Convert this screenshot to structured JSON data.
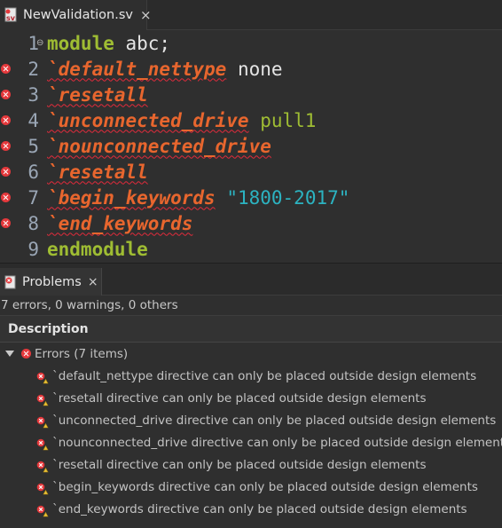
{
  "editor_tab": {
    "title": "NewValidation.sv",
    "close": "×",
    "icon": "sv-file-icon"
  },
  "code_lines": [
    {
      "num": "1",
      "error": false,
      "fold": "⊖",
      "tokens": [
        {
          "cls": "kw",
          "t": "module"
        },
        {
          "cls": "id",
          "t": " abc;"
        }
      ]
    },
    {
      "num": "2",
      "error": true,
      "fold": "",
      "tokens": [
        {
          "cls": "dir",
          "t": "`default_nettype"
        },
        {
          "cls": "id",
          "t": " none"
        }
      ]
    },
    {
      "num": "3",
      "error": true,
      "fold": "",
      "tokens": [
        {
          "cls": "dir",
          "t": "`resetall"
        }
      ]
    },
    {
      "num": "4",
      "error": true,
      "fold": "",
      "tokens": [
        {
          "cls": "dir",
          "t": "`unconnected_drive"
        },
        {
          "cls": "num",
          "t": " pull1"
        }
      ]
    },
    {
      "num": "5",
      "error": true,
      "fold": "",
      "tokens": [
        {
          "cls": "dir",
          "t": "`nounconnected_drive"
        }
      ]
    },
    {
      "num": "6",
      "error": true,
      "fold": "",
      "tokens": [
        {
          "cls": "dir",
          "t": "`resetall"
        }
      ]
    },
    {
      "num": "7",
      "error": true,
      "fold": "",
      "tokens": [
        {
          "cls": "dir",
          "t": "`begin_keywords"
        },
        {
          "cls": "id",
          "t": " "
        },
        {
          "cls": "str",
          "t": "\"1800-2017\""
        }
      ]
    },
    {
      "num": "8",
      "error": true,
      "fold": "",
      "tokens": [
        {
          "cls": "dir",
          "t": "`end_keywords"
        }
      ]
    },
    {
      "num": "9",
      "error": false,
      "fold": "",
      "tokens": [
        {
          "cls": "kw",
          "t": "endmodule"
        }
      ]
    }
  ],
  "problems": {
    "tab_title": "Problems",
    "tab_close": "×",
    "summary": "7 errors, 0 warnings, 0 others",
    "column_header": "Description",
    "group_label": "Errors (7 items)",
    "items": [
      "`default_nettype directive can only be placed outside design elements",
      "`resetall directive can only be placed outside design elements",
      "`unconnected_drive directive can only be placed outside design elements",
      "`nounconnected_drive directive can only be placed outside design elements",
      "`resetall directive can only be placed outside design elements",
      "`begin_keywords directive can only be placed outside design elements",
      "`end_keywords directive can only be placed outside design elements"
    ]
  },
  "colors": {
    "background": "#2f2f2f",
    "keyword": "#9fbd33",
    "directive": "#e8662e",
    "string": "#2cb3c1",
    "error": "#e5393c"
  }
}
